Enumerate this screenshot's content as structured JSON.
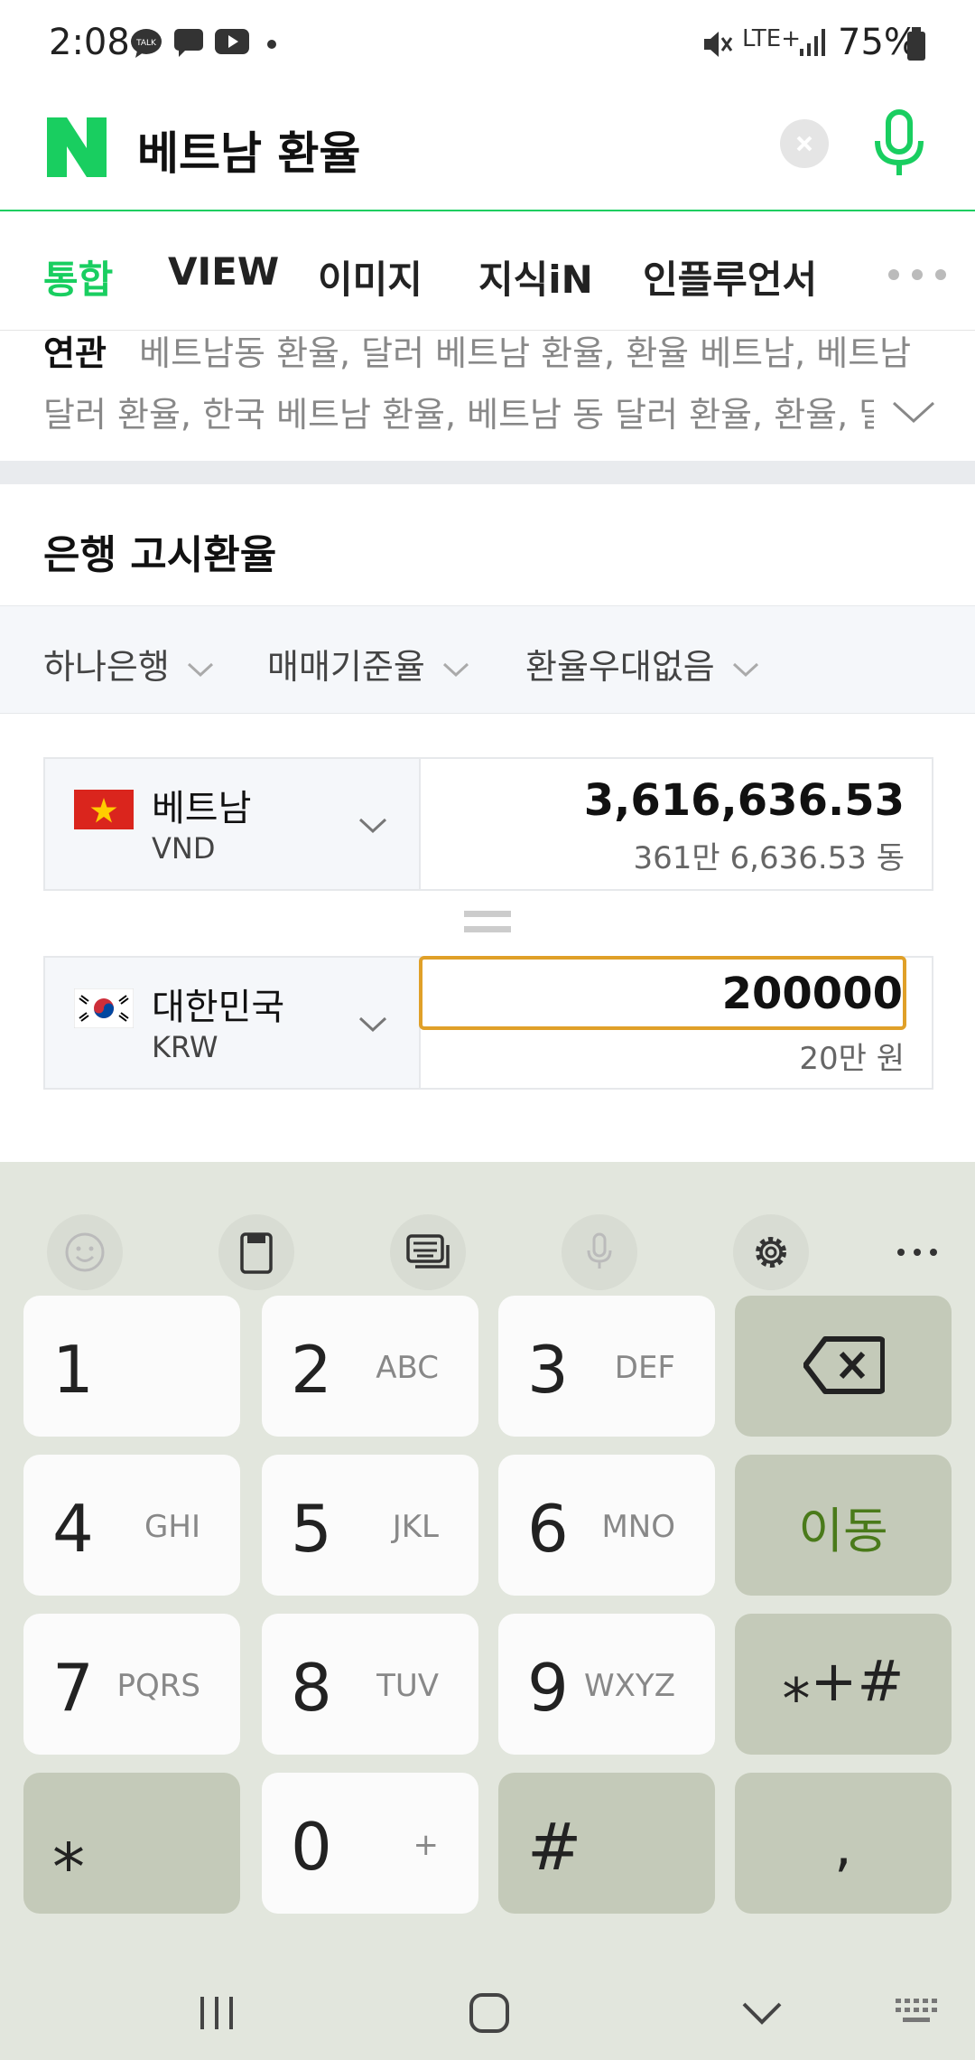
{
  "status_bar": {
    "time": "2:08",
    "network": "LTE+",
    "battery": "75%"
  },
  "search": {
    "logo": "N",
    "query": "베트남 환율"
  },
  "tabs": [
    "통합",
    "VIEW",
    "이미지",
    "지식iN",
    "인플루언서"
  ],
  "related": {
    "title": "연관",
    "line1": "베트남동 환율, 달러 베트남 환율, 환율 베트남, 베트남",
    "line2": "달러 환율, 한국 베트남 환율, 베트남 동 달러 환율, 환율, 달"
  },
  "section_title": "은행 고시환율",
  "filters": [
    "하나은행",
    "매매기준율",
    "환율우대없음"
  ],
  "from_currency": {
    "name": "베트남",
    "code": "VND",
    "value": "3,616,636.53",
    "sub": "361만 6,636.53 동"
  },
  "to_currency": {
    "name": "대한민국",
    "code": "KRW",
    "value": "200000",
    "sub": "20만 원"
  },
  "keyboard": {
    "rows": [
      [
        {
          "main": "1",
          "sub": ""
        },
        {
          "main": "2",
          "sub": "ABC"
        },
        {
          "main": "3",
          "sub": "DEF"
        }
      ],
      [
        {
          "main": "4",
          "sub": "GHI"
        },
        {
          "main": "5",
          "sub": "JKL"
        },
        {
          "main": "6",
          "sub": "MNO"
        }
      ],
      [
        {
          "main": "7",
          "sub": "PQRS"
        },
        {
          "main": "8",
          "sub": "TUV"
        },
        {
          "main": "9",
          "sub": "WXYZ"
        }
      ],
      [
        {
          "main": "⁎",
          "sub": ""
        },
        {
          "main": "0",
          "sub": "+"
        },
        {
          "main": "#",
          "sub": ""
        }
      ]
    ],
    "go_label": "이동",
    "symbols_label": "⁎+#",
    "comma_label": ","
  },
  "colors": {
    "naver_green": "#19ce60",
    "input_border": "#e0a028",
    "go_text": "#4a7a1a"
  }
}
